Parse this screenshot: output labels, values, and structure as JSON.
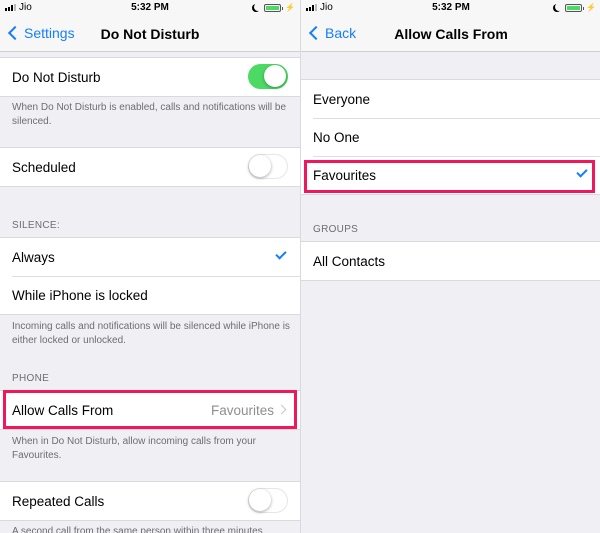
{
  "left": {
    "status": {
      "carrier": "Jio",
      "time": "5:32 PM"
    },
    "nav": {
      "back_label": "Settings",
      "title": "Do Not Disturb"
    },
    "dnd": {
      "label": "Do Not Disturb",
      "enabled": true,
      "footer": "When Do Not Disturb is enabled, calls and notifications will be silenced."
    },
    "scheduled": {
      "label": "Scheduled",
      "enabled": false
    },
    "silence": {
      "header": "SILENCE:",
      "options": [
        {
          "label": "Always",
          "selected": true
        },
        {
          "label": "While iPhone is locked",
          "selected": false
        }
      ],
      "footer": "Incoming calls and notifications will be silenced while iPhone is either locked or unlocked."
    },
    "phone": {
      "header": "PHONE",
      "allow_calls_label": "Allow Calls From",
      "allow_calls_value": "Favourites",
      "footer": "When in Do Not Disturb, allow incoming calls from your Favourites."
    },
    "repeated": {
      "label": "Repeated Calls",
      "enabled": false,
      "footer": "A second call from the same person within three minutes"
    }
  },
  "right": {
    "status": {
      "carrier": "Jio",
      "time": "5:32 PM"
    },
    "nav": {
      "back_label": "Back",
      "title": "Allow Calls From"
    },
    "options": [
      {
        "label": "Everyone",
        "selected": false
      },
      {
        "label": "No One",
        "selected": false
      },
      {
        "label": "Favourites",
        "selected": true
      }
    ],
    "groups": {
      "header": "GROUPS",
      "items": [
        {
          "label": "All Contacts"
        }
      ]
    }
  },
  "colors": {
    "accent": "#157efb",
    "toggle_on": "#4cd964",
    "highlight": "#f0185a"
  }
}
